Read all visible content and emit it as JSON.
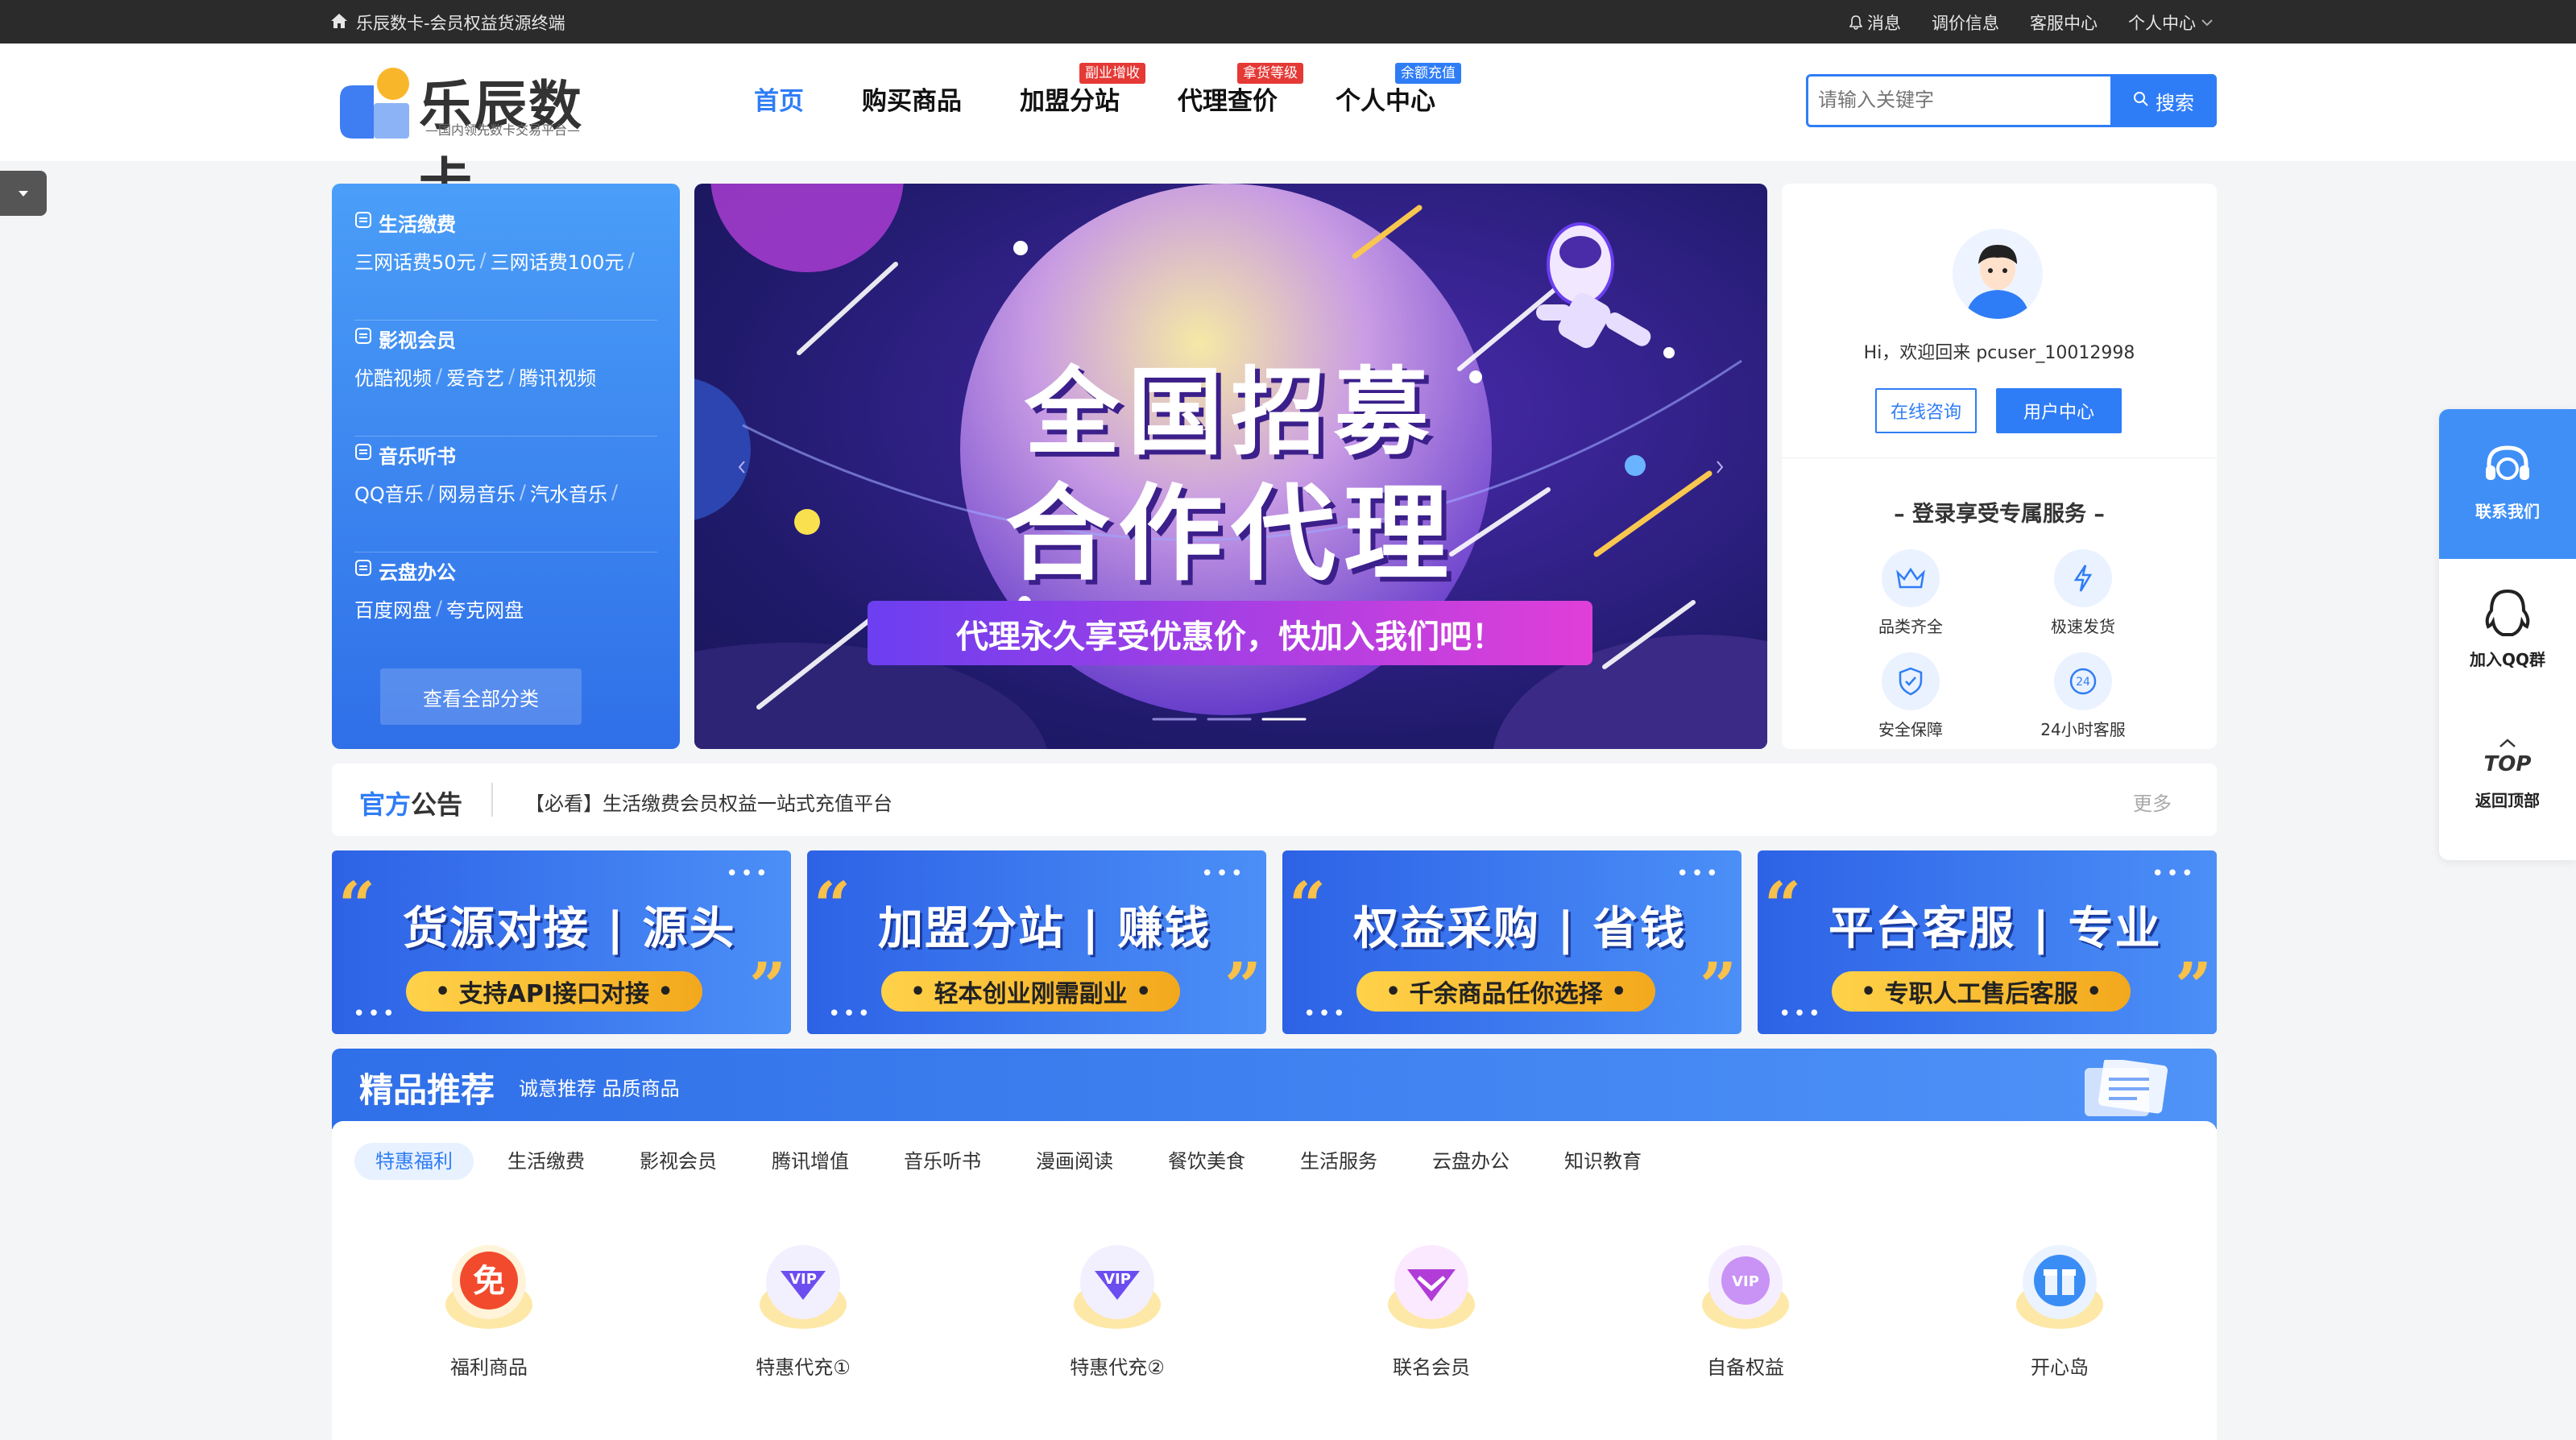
{
  "topbar": {
    "site_title": "乐辰数卡-会员权益货源终端",
    "links": [
      "消息",
      "调价信息",
      "客服中心",
      "个人中心"
    ]
  },
  "logo": {
    "name": "乐辰数卡",
    "slogan": "—国内领先数卡交易平台—"
  },
  "nav": {
    "items": [
      {
        "label": "首页",
        "tag": ""
      },
      {
        "label": "购买商品",
        "tag": ""
      },
      {
        "label": "加盟分站",
        "tag": "副业增收"
      },
      {
        "label": "代理查价",
        "tag": "拿货等级"
      },
      {
        "label": "个人中心",
        "tag": "余额充值"
      }
    ]
  },
  "search": {
    "placeholder": "请输入关键字",
    "button": "搜索"
  },
  "categories": {
    "groups": [
      {
        "title": "生活缴费",
        "items": [
          "三网话费50元",
          "三网话费100元"
        ]
      },
      {
        "title": "影视会员",
        "items": [
          "优酷视频",
          "爱奇艺",
          "腾讯视频"
        ]
      },
      {
        "title": "音乐听书",
        "items": [
          "QQ音乐",
          "网易音乐",
          "汽水音乐"
        ]
      },
      {
        "title": "云盘办公",
        "items": [
          "百度网盘",
          "夸克网盘"
        ]
      }
    ],
    "view_all": "查看全部分类"
  },
  "banner": {
    "line1": "全国招募",
    "line2": "合作代理",
    "cta": "代理永久享受优惠价，快加入我们吧！"
  },
  "user": {
    "greeting": "Hi，欢迎回来 pcuser_10012998",
    "consult": "在线咨询",
    "center": "用户中心",
    "login_title": "– 登录享受专属服务 –",
    "features": [
      "品类齐全",
      "极速发货",
      "安全保障",
      "24小时客服"
    ]
  },
  "notice": {
    "title_a": "官方",
    "title_b": "公告",
    "text": "【必看】生活缴费会员权益一站式充值平台",
    "more": "更多"
  },
  "promos": [
    {
      "h1": "货源对接",
      "h2": "源头",
      "pill": "支持API接口对接"
    },
    {
      "h1": "加盟分站",
      "h2": "赚钱",
      "pill": "轻本创业刚需副业"
    },
    {
      "h1": "权益采购",
      "h2": "省钱",
      "pill": "千余商品任你选择"
    },
    {
      "h1": "平台客服",
      "h2": "专业",
      "pill": "专职人工售后客服"
    }
  ],
  "recommend": {
    "title": "精品推荐",
    "subtitle": "诚意推荐 品质商品",
    "tabs": [
      "特惠福利",
      "生活缴费",
      "影视会员",
      "腾讯增值",
      "音乐听书",
      "漫画阅读",
      "餐饮美食",
      "生活服务",
      "云盘办公",
      "知识教育"
    ],
    "items": [
      {
        "label": "福利商品",
        "icon": "free-icon",
        "glyph": "免"
      },
      {
        "label": "特惠代充①",
        "icon": "vip-icon",
        "glyph": "VIP"
      },
      {
        "label": "特惠代充②",
        "icon": "vip-icon",
        "glyph": "VIP"
      },
      {
        "label": "联名会员",
        "icon": "diamond-icon",
        "glyph": ""
      },
      {
        "label": "自备权益",
        "icon": "vip-icon",
        "glyph": "VIP"
      },
      {
        "label": "开心岛",
        "icon": "gift-icon",
        "glyph": ""
      }
    ]
  },
  "floatbar": {
    "contact": "联系我们",
    "qq": "加入QQ群",
    "top_glyph": "TOP",
    "back_top": "返回顶部"
  },
  "colors": {
    "brand_blue": "#2f7df6",
    "tag_red": "#e53935",
    "topbar": "#2b2b2b",
    "accent_yellow": "#f8c14a"
  }
}
